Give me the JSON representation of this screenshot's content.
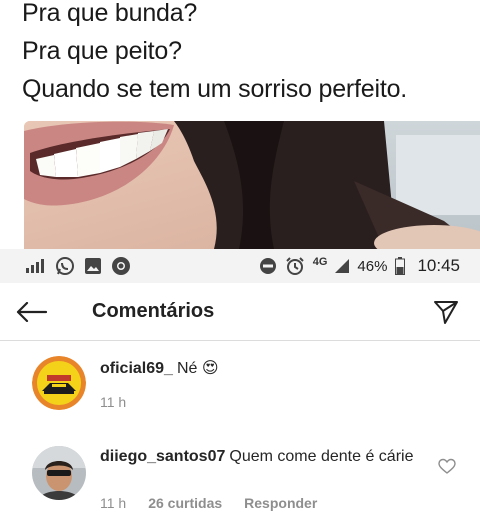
{
  "caption": {
    "lines": [
      "Pra que bunda?",
      "Pra que peito?",
      "Quando se tem um sorriso perfeito."
    ]
  },
  "statusbar": {
    "network": "4G",
    "battery": "46%",
    "time": "10:45",
    "left_icons": [
      "signal-icon",
      "whatsapp-icon",
      "gallery-icon",
      "chrome-icon"
    ],
    "right_icons": [
      "dnd-icon",
      "alarm-icon",
      "cell-signal-icon",
      "battery-icon"
    ]
  },
  "header": {
    "title": "Comentários"
  },
  "comments": [
    {
      "username": "oficial69_",
      "text": "Né 😍",
      "time": "11 h"
    },
    {
      "username": "diiego_santos07",
      "text": "Quem come dente é cárie",
      "time": "11 h",
      "likes": "26 curtidas",
      "reply": "Responder"
    }
  ],
  "colors": {
    "avatar_yellow": "#f5d21a",
    "avatar_orange": "#e8852a",
    "status_bg": "#f3f3f3",
    "meta_gray": "#8e8e8e"
  }
}
